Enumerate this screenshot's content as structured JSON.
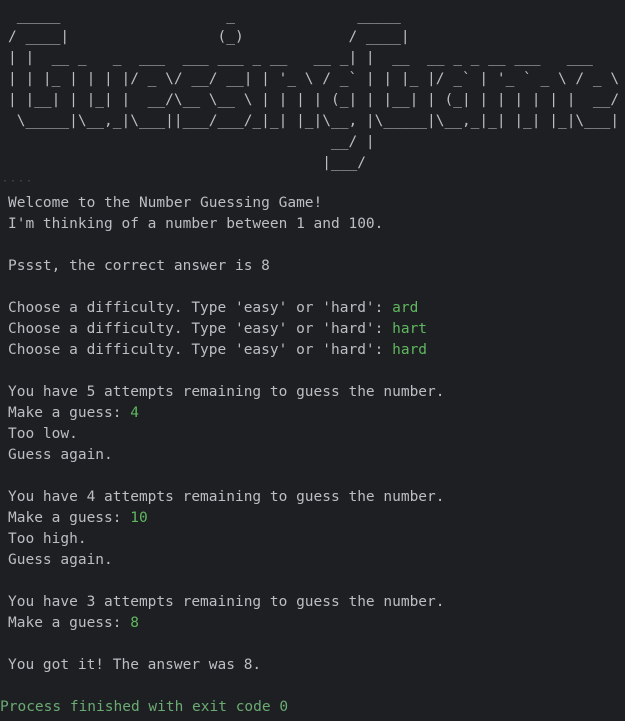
{
  "banner": " _____                   _              _____\n/ ____|                 (_)            / ____|\n| |  __ _   _  ___  ___ ___ _ __   __ _| |  __  __ _ _ __ ___   ___\n| | |_ | | | |/ _ \\/ __/ __| | '_ \\ / _` | | |_ |/ _` | '_ ` _ \\ / _ \\\n| |__| | |_| |  __/\\__ \\__ \\ | | | | (_| | |__| | (_| | | | | | |  __/\n \\_____|\\__,_|\\___||___/___/_|_| |_|\\__, |\\_____|\\__,_|_| |_| |_|\\___|\n                                     __/ |\n                                    |___/",
  "welcome": "Welcome to the Number Guessing Game!",
  "thinking": "I'm thinking of a number between 1 and 100.",
  "hint": "Pssst, the correct answer is 8",
  "difficulty": {
    "prompt": "Choose a difficulty. Type 'easy' or 'hard': ",
    "answers": [
      "ard",
      "hart",
      "hard"
    ]
  },
  "rounds": [
    {
      "attempts": "You have 5 attempts remaining to guess the number.",
      "prompt": "Make a guess: ",
      "guess": "4",
      "feedback": "Too low.",
      "again": "Guess again."
    },
    {
      "attempts": "You have 4 attempts remaining to guess the number.",
      "prompt": "Make a guess: ",
      "guess": "10",
      "feedback": "Too high.",
      "again": "Guess again."
    },
    {
      "attempts": "You have 3 attempts remaining to guess the number.",
      "prompt": "Make a guess: ",
      "guess": "8"
    }
  ],
  "result": "You got it! The answer was 8.",
  "process_exit": "Process finished with exit code 0",
  "colors": {
    "background": "#1e1f22",
    "output_text": "#bcbec4",
    "user_input": "#5fb85f",
    "process_message": "#6aab73"
  }
}
